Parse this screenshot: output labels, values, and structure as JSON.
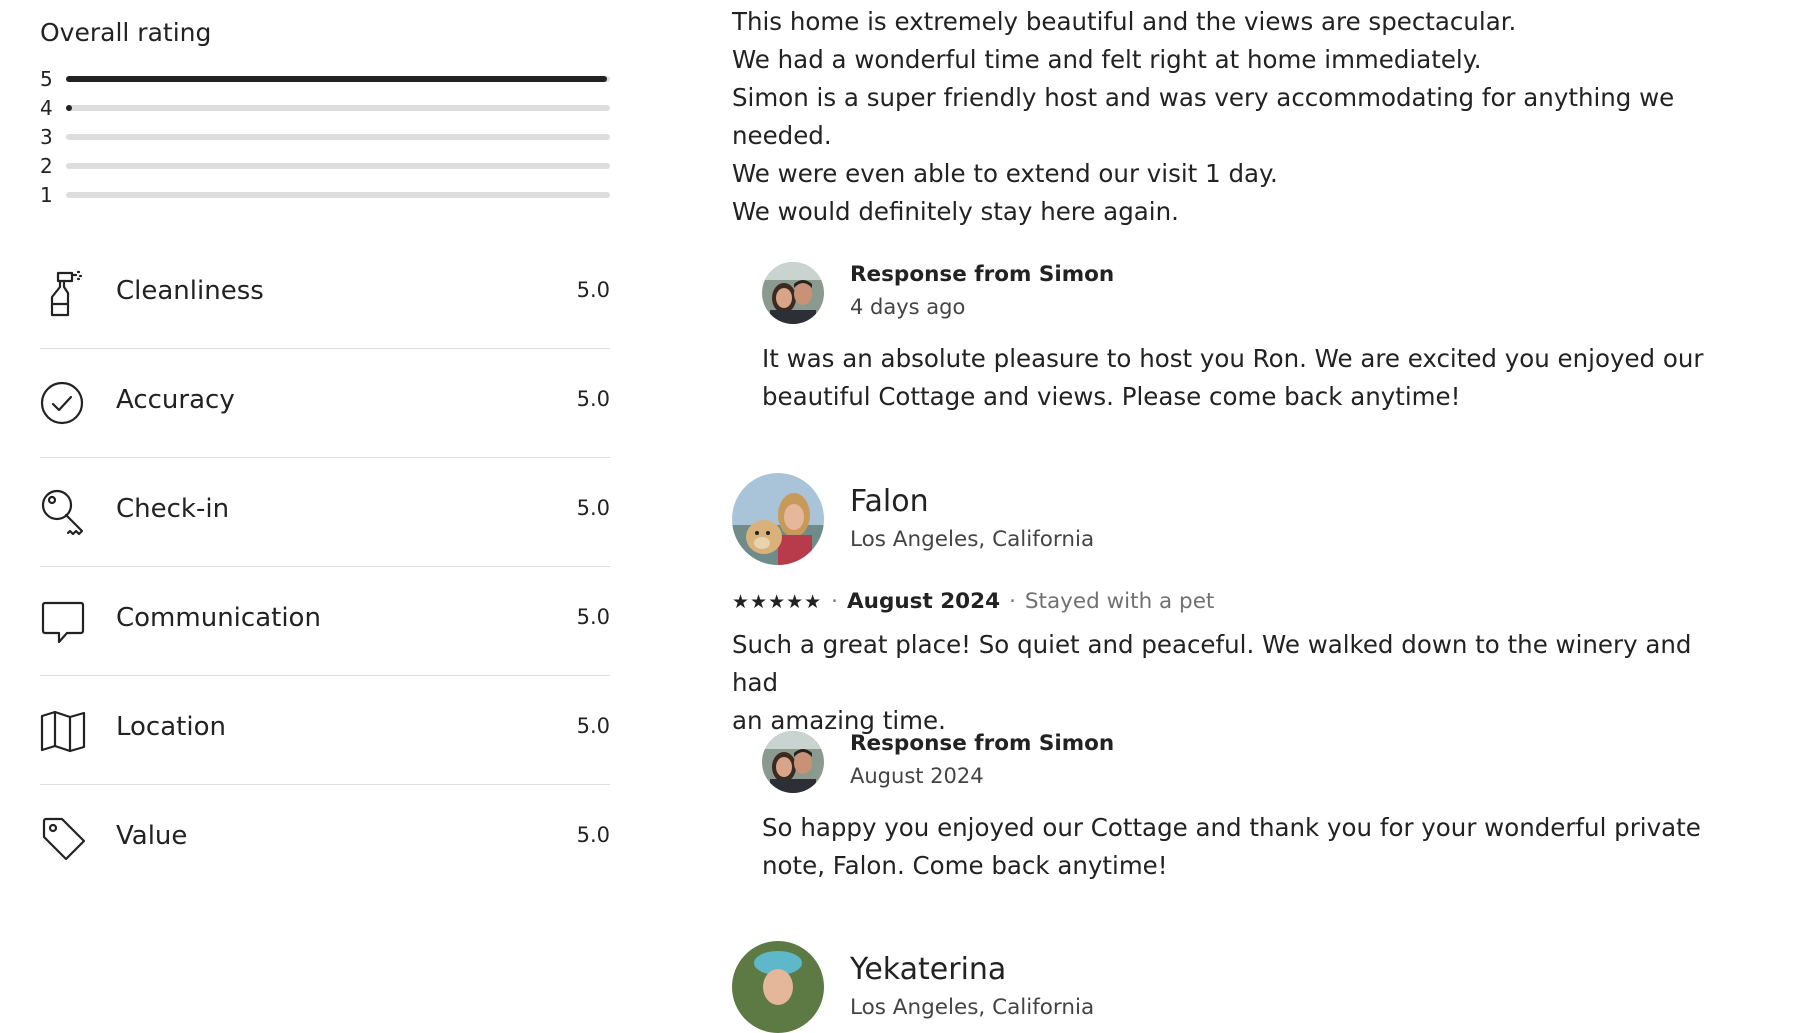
{
  "overall": {
    "title": "Overall rating",
    "distribution": [
      {
        "star": "5",
        "fraction": 0.995
      },
      {
        "star": "4",
        "fraction": 0.01
      },
      {
        "star": "3",
        "fraction": 0
      },
      {
        "star": "2",
        "fraction": 0
      },
      {
        "star": "1",
        "fraction": 0
      }
    ]
  },
  "categories": [
    {
      "label": "Cleanliness",
      "score": "5.0",
      "icon": "spray-bottle-icon"
    },
    {
      "label": "Accuracy",
      "score": "5.0",
      "icon": "check-circle-icon"
    },
    {
      "label": "Check-in",
      "score": "5.0",
      "icon": "key-icon"
    },
    {
      "label": "Communication",
      "score": "5.0",
      "icon": "chat-bubble-icon"
    },
    {
      "label": "Location",
      "score": "5.0",
      "icon": "map-icon"
    },
    {
      "label": "Value",
      "score": "5.0",
      "icon": "tag-icon"
    }
  ],
  "reviews": [
    {
      "text_lines": [
        "This home is extremely beautiful and the views are spectacular.",
        "We had a wonderful time and felt right at home immediately.",
        "Simon is a super friendly host and was very accommodating for anything we",
        "needed.",
        "We were even able to extend our visit 1 day.",
        "We would definitely stay here again."
      ],
      "response": {
        "from": "Response from Simon",
        "date": "4 days ago",
        "text_lines": [
          "It was an absolute pleasure to host you Ron. We are excited you enjoyed our",
          "beautiful Cottage and views. Please come back anytime!"
        ]
      }
    },
    {
      "name": "Falon",
      "location": "Los Angeles, California",
      "stars": "★★★★★",
      "separator": "·",
      "date": "August 2024",
      "extra": "Stayed with a pet",
      "text_lines": [
        "Such a great place! So quiet and peaceful. We walked down to the winery and had",
        "an amazing time."
      ],
      "response": {
        "from": "Response from Simon",
        "date": "August 2024",
        "text_lines": [
          "So happy you enjoyed our Cottage and thank you for your wonderful private",
          "note, Falon. Come back anytime!"
        ]
      }
    },
    {
      "name": "Yekaterina",
      "location": "Los Angeles, California"
    }
  ],
  "colors": {
    "text": "#222222",
    "muted": "#717171",
    "divider": "#dddddd",
    "bar": "#222222"
  }
}
